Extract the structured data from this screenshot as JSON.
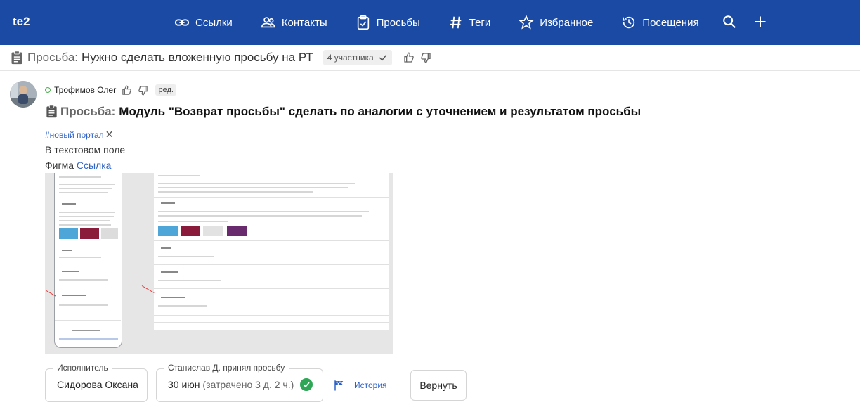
{
  "app": {
    "brand": "te2"
  },
  "nav": {
    "items": [
      {
        "label": "Ссылки",
        "icon": "link-icon"
      },
      {
        "label": "Контакты",
        "icon": "people-icon"
      },
      {
        "label": "Просьбы",
        "icon": "clipboard-check-icon"
      },
      {
        "label": "Теги",
        "icon": "hash-icon"
      },
      {
        "label": "Избранное",
        "icon": "star-icon"
      },
      {
        "label": "Посещения",
        "icon": "history-icon"
      }
    ],
    "actions": [
      "search-icon",
      "plus-icon"
    ]
  },
  "thread": {
    "prefix": "Просьба:",
    "title": "Нужно сделать вложенную просьбу на РТ",
    "participants": "4 участника"
  },
  "post": {
    "author": "Трофимов Олег",
    "edited_badge": "ред.",
    "prefix": "Просьба:",
    "title": "Модуль \"Возврат просьбы\" сделать по аналогии с уточнением и результатом просьбы",
    "tag": "#новый портал",
    "tag_remove": "✕",
    "line1": "В текстовом поле",
    "line2_text": "Фигма",
    "line2_link": "Ссылка"
  },
  "footer": {
    "executor_label": "Исполнитель",
    "executor_value": "Сидорова Оксана",
    "accepted_label": "Станислав Д. принял просьбу",
    "accepted_date": "30 июн",
    "accepted_spent": "(затрачено 3 д. 2 ч.)",
    "history_label": "История",
    "return_label": "Вернуть"
  },
  "colors": {
    "topbar": "#1a4aa3",
    "link": "#2f62c6",
    "online": "#4caf50",
    "check": "#2ea655"
  }
}
